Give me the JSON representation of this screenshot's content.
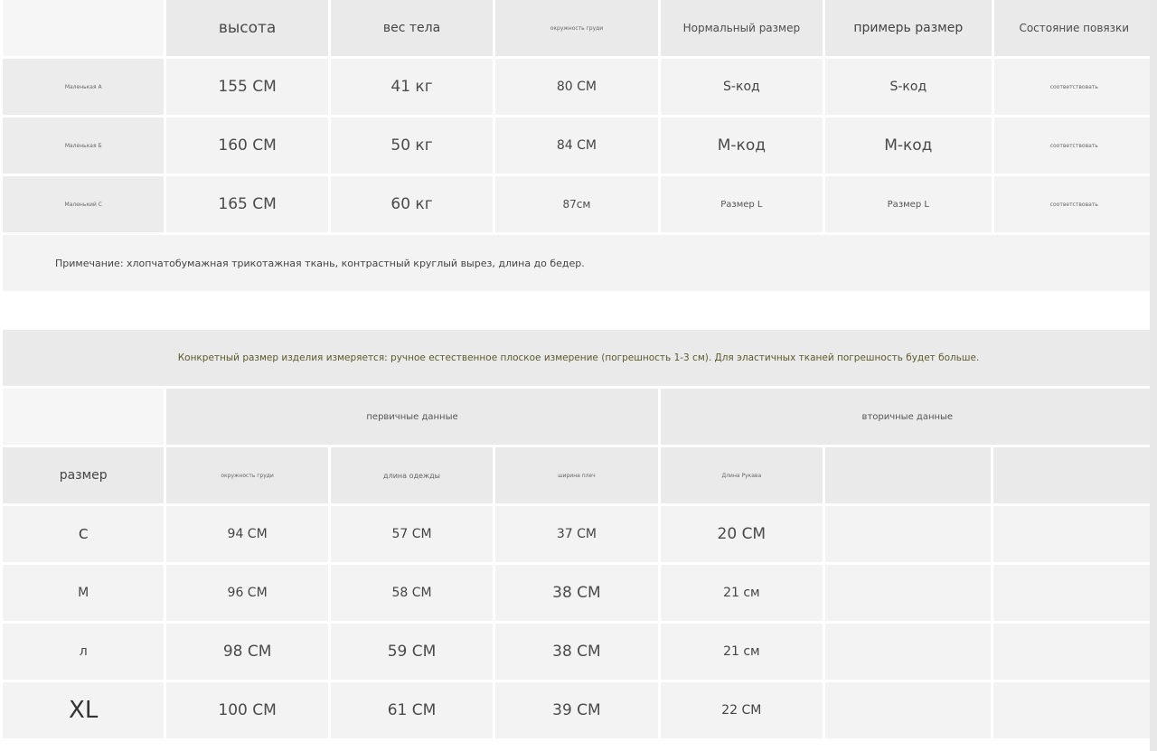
{
  "table1": {
    "headers": [
      "",
      "высота",
      "вес тела",
      "окружность груди",
      "Нормальный размер",
      "примерь размер",
      "Состояние повязки"
    ],
    "rows": [
      [
        "Маленькая A",
        "155 СМ",
        "41 кг",
        "80 СМ",
        "S-код",
        "S-код",
        "соответствовать"
      ],
      [
        "Маленькая Б",
        "160 СМ",
        "50 кг",
        "84 СМ",
        "М-код",
        "М-код",
        "соответствовать"
      ],
      [
        "Маленький C",
        "165 СМ",
        "60 кг",
        "87см",
        "Размер L",
        "Размер L",
        "соответствовать"
      ]
    ],
    "note": "Примечание: хлопчатобумажная трикотажная ткань, контрастный круглый вырез, длина до бедер."
  },
  "table2": {
    "spec": "Конкретный размер изделия измеряется: ручное естественное плоское измерение (погрешность 1-3 см). Для эластичных тканей погрешность будет больше.",
    "group_primary": "первичные данные",
    "group_secondary": "вторичные данные",
    "headers": [
      "размер",
      "окружность груди",
      "длина одежды",
      "ширина плеч",
      "Длина Рукава",
      "",
      ""
    ],
    "rows": [
      [
        "С",
        "94 СМ",
        "57 СМ",
        "37 СМ",
        "20 СМ"
      ],
      [
        "М",
        "96 СМ",
        "58 СМ",
        "38 СМ",
        "21 см"
      ],
      [
        "л",
        "98 СМ",
        "59 СМ",
        "38 СМ",
        "21 см"
      ],
      [
        "XL",
        "100 СМ",
        "61 СМ",
        "39 СМ",
        "22 СМ"
      ]
    ]
  }
}
